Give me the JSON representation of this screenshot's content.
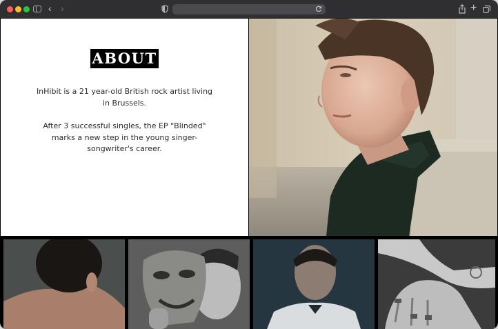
{
  "browser": {
    "address_text": ""
  },
  "about": {
    "title": "ABOUT",
    "paragraph_1": "InHibit is a 21 year-old British rock artist living in Brussels.",
    "paragraph_2": "After 3 successful singles, the EP \"Blinded\" marks a new step in the young singer-songwriter's career."
  },
  "icons": {
    "back": "chevron-left-icon",
    "forward": "chevron-right-icon",
    "plus": "plus-icon"
  }
}
